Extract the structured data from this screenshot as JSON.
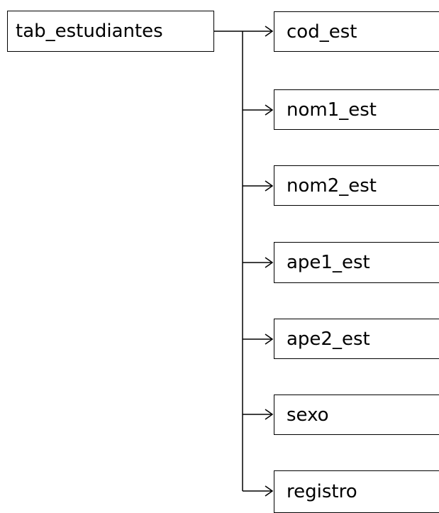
{
  "root": {
    "label": "tab_estudiantes"
  },
  "fields": [
    {
      "label": "cod_est"
    },
    {
      "label": "nom1_est"
    },
    {
      "label": "nom2_est"
    },
    {
      "label": "ape1_est"
    },
    {
      "label": "ape2_est"
    },
    {
      "label": "sexo"
    },
    {
      "label": "registro"
    }
  ],
  "colors": {
    "line": "#000000",
    "box_border": "#000000",
    "background": "#ffffff"
  }
}
